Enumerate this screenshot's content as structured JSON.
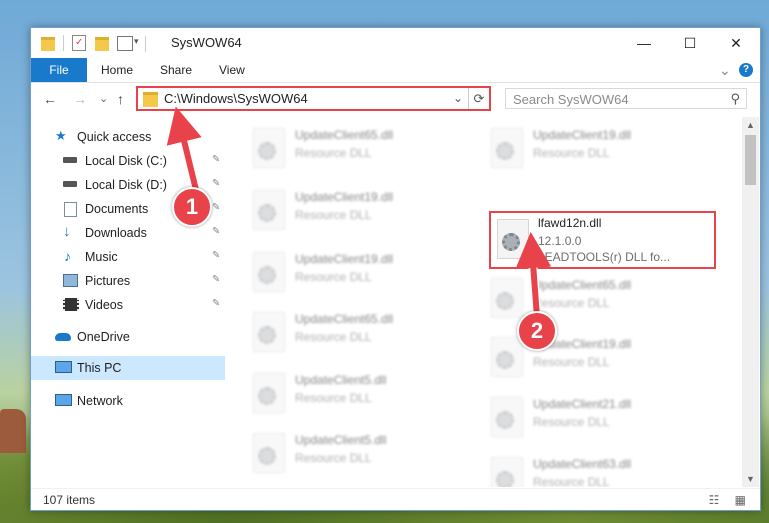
{
  "window": {
    "title": "SysWOW64",
    "controls": {
      "minimize": "—",
      "maximize": "☐",
      "close": "✕"
    }
  },
  "ribbon": {
    "tabs": [
      "File",
      "Home",
      "Share",
      "View"
    ],
    "expand": "⌄",
    "help": "?"
  },
  "navigation": {
    "back": "←",
    "forward": "→",
    "recent": "⌄",
    "up": "↑",
    "address": "C:\\Windows\\SysWOW64",
    "address_dropdown": "⌄",
    "refresh": "⟳",
    "search_placeholder": "Search SysWOW64"
  },
  "sidebar": {
    "items": [
      {
        "label": "Quick access",
        "icon": "star-icon"
      },
      {
        "label": "Local Disk (C:)",
        "icon": "drive-icon"
      },
      {
        "label": "Local Disk (D:)",
        "icon": "drive-icon"
      },
      {
        "label": "Documents",
        "icon": "documents-icon"
      },
      {
        "label": "Downloads",
        "icon": "download-icon"
      },
      {
        "label": "Music",
        "icon": "music-icon"
      },
      {
        "label": "Pictures",
        "icon": "pictures-icon"
      },
      {
        "label": "Videos",
        "icon": "videos-icon"
      },
      {
        "label": "OneDrive",
        "icon": "cloud-icon"
      },
      {
        "label": "This PC",
        "icon": "computer-icon"
      },
      {
        "label": "Network",
        "icon": "network-icon"
      }
    ],
    "pin": "📌"
  },
  "files": {
    "left": [
      {
        "name": "UpdateClient65.dll",
        "type": "Resource DLL"
      },
      {
        "name": "UpdateClient19.dll",
        "type": "Resource DLL"
      },
      {
        "name": "UpdateClient19.dll",
        "type": "Resource DLL"
      },
      {
        "name": "UpdateClient65.dll",
        "type": "Resource DLL"
      },
      {
        "name": "UpdateClient5.dll",
        "type": "Resource DLL"
      },
      {
        "name": "UpdateClient5.dll",
        "type": "Resource DLL"
      }
    ],
    "right": [
      {
        "name": "UpdateClient19.dll",
        "type": "Resource DLL"
      },
      {
        "name": "lfawd12n.dll",
        "version": "12.1.0.0",
        "desc": "LEADTOOLS(r) DLL fo..."
      },
      {
        "name": "UpdateClient65.dll",
        "type": "Resource DLL"
      },
      {
        "name": "UpdateClient19.dll",
        "type": "Resource DLL"
      },
      {
        "name": "UpdateClient21.dll",
        "type": "Resource DLL"
      },
      {
        "name": "UpdateClient63.dll",
        "type": "Resource DLL"
      }
    ]
  },
  "status": {
    "items_count": "107 items",
    "view_icons": "☷ ▦"
  },
  "callouts": [
    "1",
    "2"
  ],
  "colors": {
    "highlight": "#e8424a",
    "file_tab": "#1979ca",
    "selected": "#cce8ff"
  }
}
